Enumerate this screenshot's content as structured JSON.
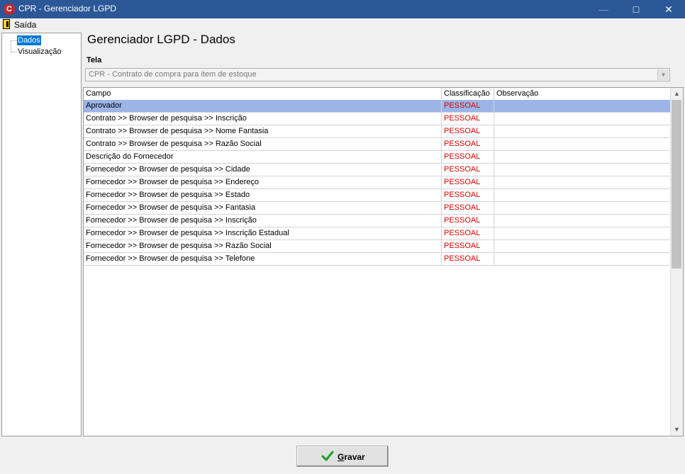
{
  "window": {
    "title": "CPR - Gerenciador LGPD",
    "icon": "cpr-app-icon",
    "controls": [
      "minimize",
      "maximize",
      "close"
    ]
  },
  "menubar": {
    "items": [
      {
        "label": "Saída",
        "icon": "exit-door-icon"
      }
    ]
  },
  "tree": {
    "items": [
      {
        "label": "Dados",
        "selected": true
      },
      {
        "label": "Visualização",
        "selected": false
      }
    ]
  },
  "page": {
    "title": "Gerenciador LGPD - Dados"
  },
  "tela": {
    "label": "Tela",
    "value": "CPR - Contrato de compra para item de estoque"
  },
  "grid": {
    "columns": [
      "Campo",
      "Classificação",
      "Observação"
    ],
    "selected_row": 0,
    "classification_color": "#e00000",
    "selection_color": "#9db4e8",
    "rows": [
      {
        "campo": "Aprovador",
        "classificacao": "PESSOAL",
        "observacao": ""
      },
      {
        "campo": "Contrato >> Browser de pesquisa >> Inscrição",
        "classificacao": "PESSOAL",
        "observacao": ""
      },
      {
        "campo": "Contrato >> Browser de pesquisa >> Nome Fantasia",
        "classificacao": "PESSOAL",
        "observacao": ""
      },
      {
        "campo": "Contrato >> Browser de pesquisa >> Razão Social",
        "classificacao": "PESSOAL",
        "observacao": ""
      },
      {
        "campo": "Descrição do Fornecedor",
        "classificacao": "PESSOAL",
        "observacao": ""
      },
      {
        "campo": "Fornecedor >> Browser de pesquisa >> Cidade",
        "classificacao": "PESSOAL",
        "observacao": ""
      },
      {
        "campo": "Fornecedor >> Browser de pesquisa >> Endereço",
        "classificacao": "PESSOAL",
        "observacao": ""
      },
      {
        "campo": "Fornecedor >> Browser de pesquisa >> Estado",
        "classificacao": "PESSOAL",
        "observacao": ""
      },
      {
        "campo": "Fornecedor >> Browser de pesquisa >> Fantasia",
        "classificacao": "PESSOAL",
        "observacao": ""
      },
      {
        "campo": "Fornecedor >> Browser de pesquisa >> Inscrição",
        "classificacao": "PESSOAL",
        "observacao": ""
      },
      {
        "campo": "Fornecedor >> Browser de pesquisa >> Inscrição Estadual",
        "classificacao": "PESSOAL",
        "observacao": ""
      },
      {
        "campo": "Fornecedor >> Browser de pesquisa >> Razão Social",
        "classificacao": "PESSOAL",
        "observacao": ""
      },
      {
        "campo": "Fornecedor >> Browser de pesquisa >> Telefone",
        "classificacao": "PESSOAL",
        "observacao": ""
      }
    ]
  },
  "actions": {
    "save_label_accel": "G",
    "save_label_rest": "ravar",
    "save_icon": "green-check-icon"
  },
  "colors": {
    "titlebar": "#2b5797",
    "check_green": "#1e9e2a"
  }
}
